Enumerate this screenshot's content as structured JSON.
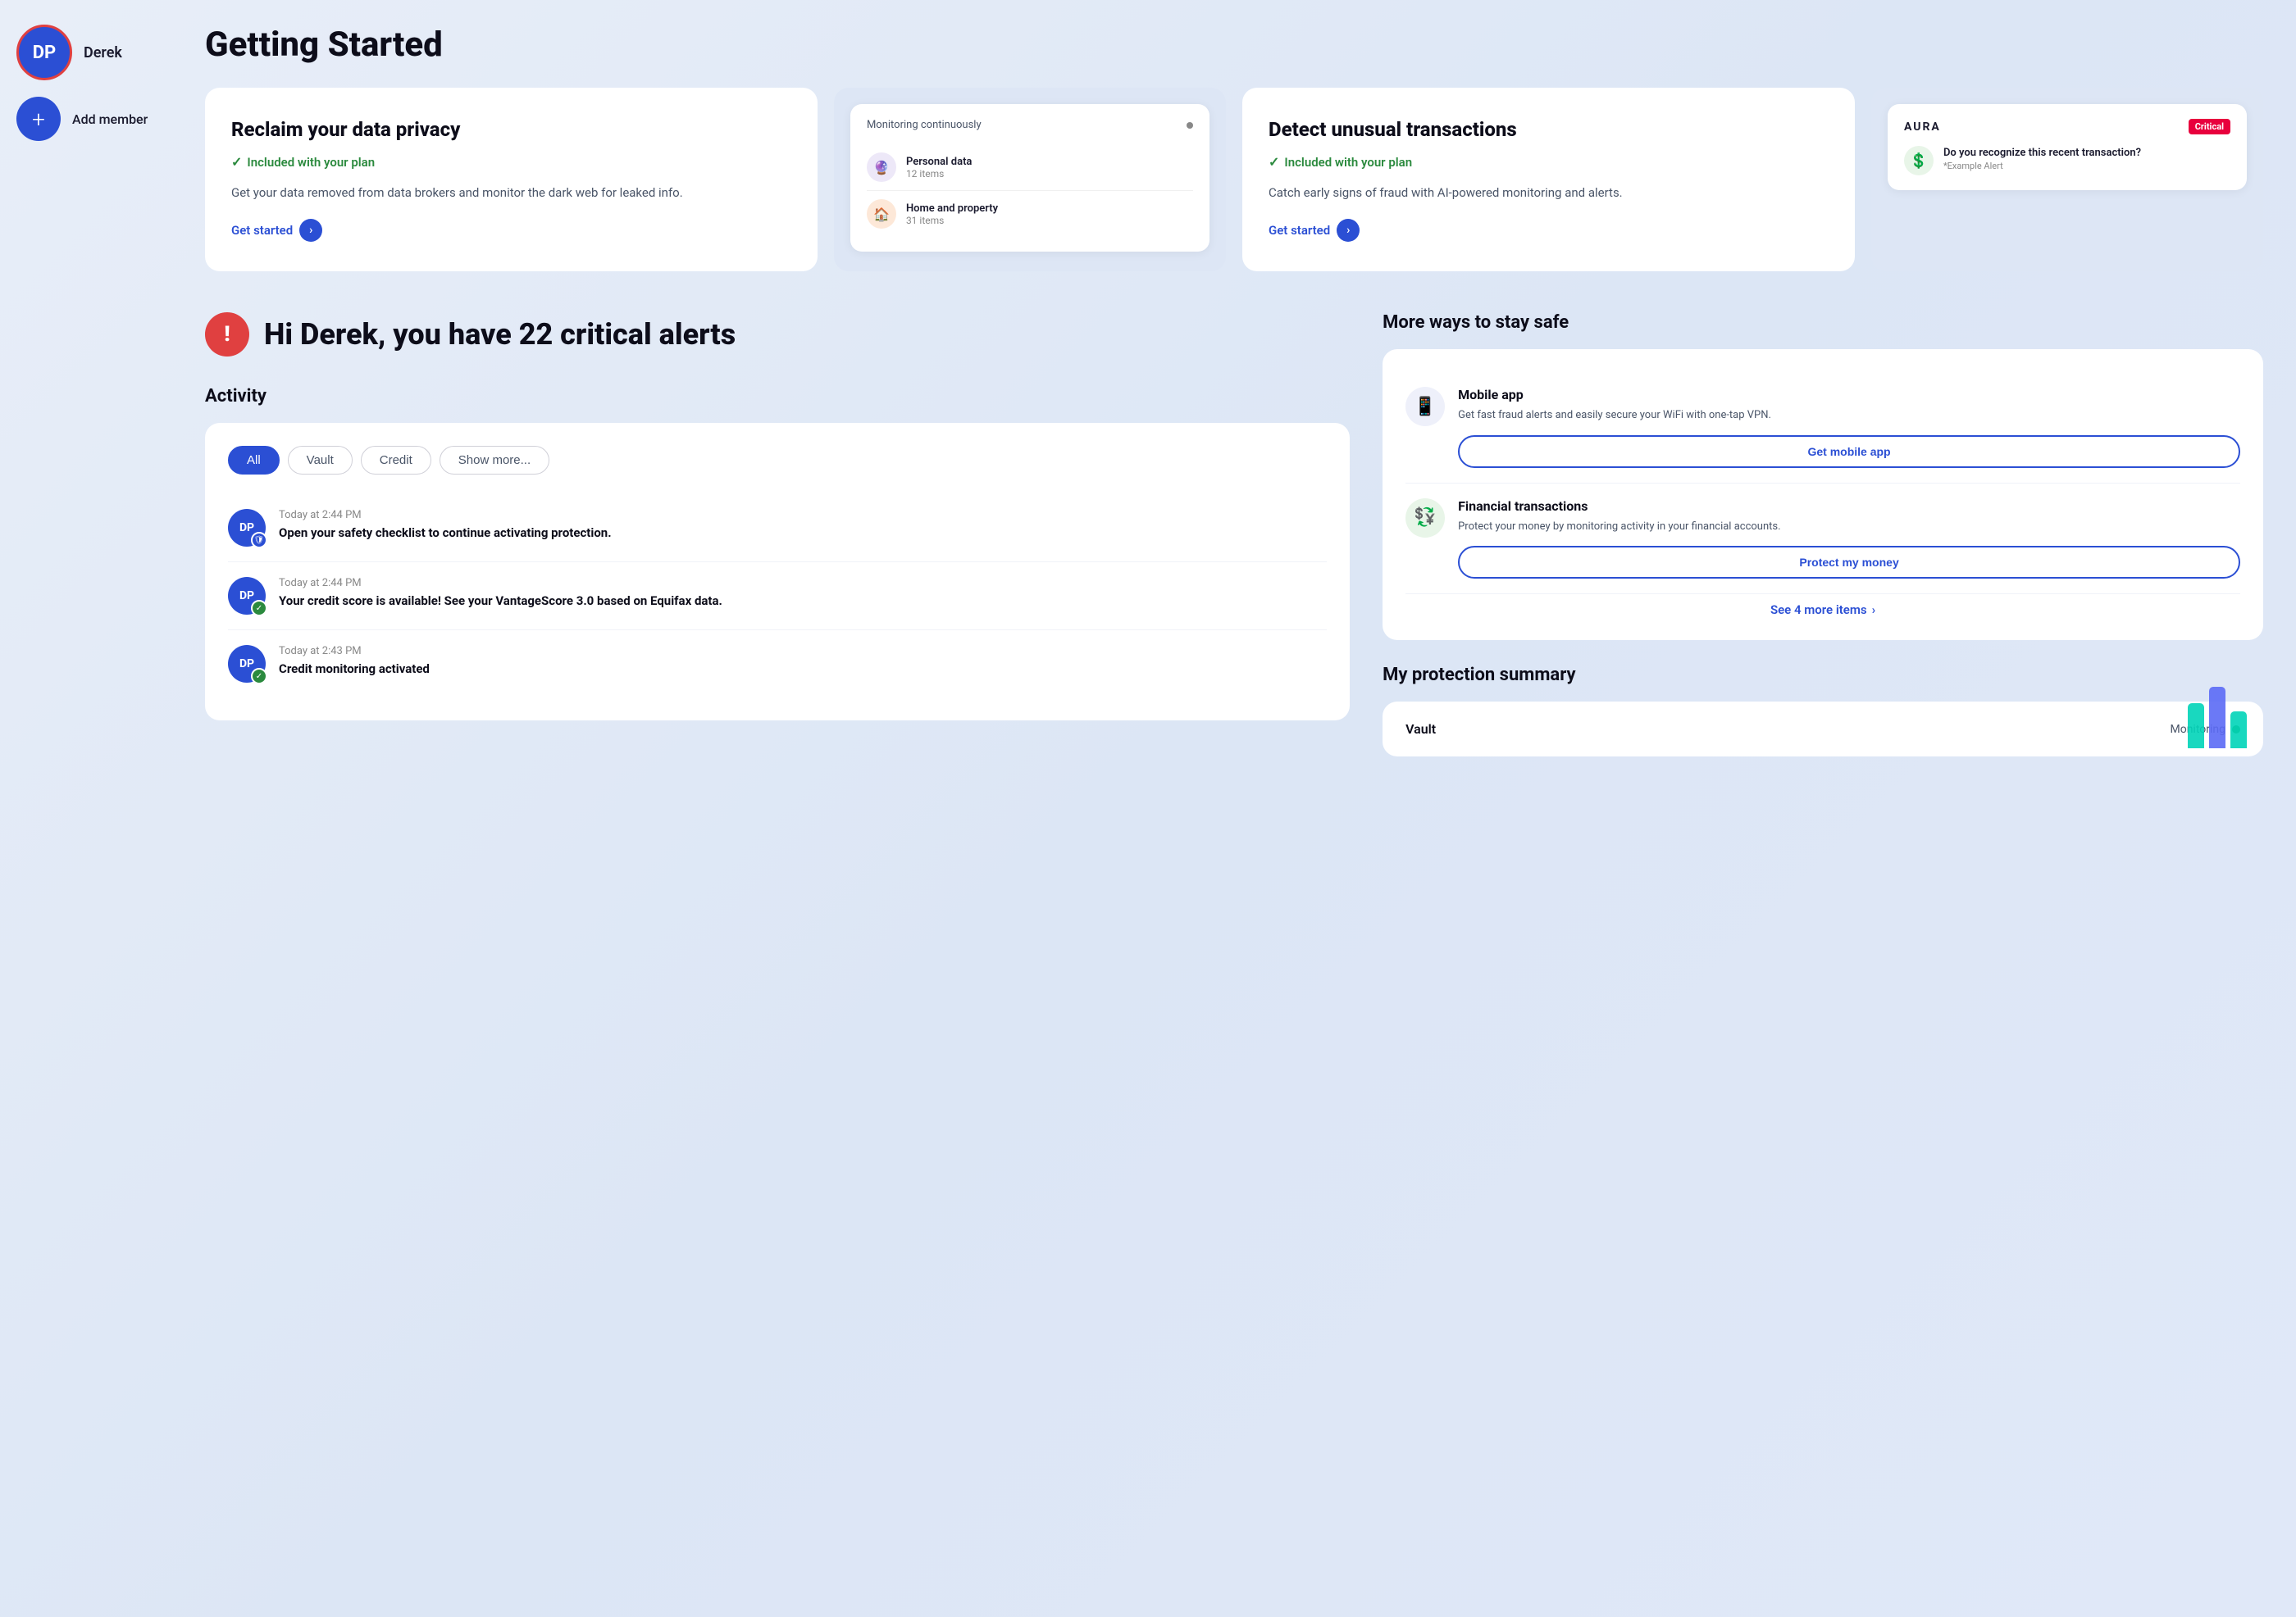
{
  "sidebar": {
    "user_initials": "DP",
    "user_name": "Derek",
    "add_member_label": "Add member",
    "add_icon": "+"
  },
  "header": {
    "title": "Getting Started"
  },
  "cards": [
    {
      "id": "data-privacy",
      "title": "Reclaim your data privacy",
      "badge": "Included with your plan",
      "description": "Get your data removed from data brokers and monitor the dark web for leaked info.",
      "link_label": "Get started"
    },
    {
      "id": "monitoring",
      "header_label": "Monitoring continuously",
      "items": [
        {
          "icon": "🔮",
          "title": "Personal data",
          "count": "12 items"
        },
        {
          "icon": "🏠",
          "title": "Home and property",
          "count": "31 items"
        }
      ]
    },
    {
      "id": "unusual-transactions",
      "title": "Detect unusual transactions",
      "badge": "Included with your plan",
      "description": "Catch early signs of fraud with AI-powered monitoring and alerts.",
      "link_label": "Get started"
    },
    {
      "id": "aura-alert",
      "logo": "AURA",
      "badge": "Critical",
      "alert_text": "Do you recognize this recent transaction?",
      "alert_sub": "*Example Alert"
    }
  ],
  "alert": {
    "user_name": "Derek",
    "count": "22",
    "title": "Hi Derek, you have 22 critical alerts"
  },
  "activity": {
    "section_title": "Activity",
    "filters": [
      {
        "label": "All",
        "active": true
      },
      {
        "label": "Vault",
        "active": false
      },
      {
        "label": "Credit",
        "active": false
      },
      {
        "label": "Show more...",
        "active": false
      }
    ],
    "items": [
      {
        "initials": "DP",
        "time": "Today at 2:44 PM",
        "text": "Open your safety checklist to continue activating protection.",
        "badge_type": "shield"
      },
      {
        "initials": "DP",
        "time": "Today at 2:44 PM",
        "text": "Your credit score is available! See your VantageScore 3.0 based on Equifax data.",
        "badge_type": "check-green"
      },
      {
        "initials": "DP",
        "time": "Today at 2:43 PM",
        "text": "Credit monitoring activated",
        "badge_type": "check-green"
      }
    ]
  },
  "stay_safe": {
    "title": "More ways to stay safe",
    "items": [
      {
        "icon": "📱",
        "icon_bg": "light-blue",
        "title": "Mobile app",
        "description": "Get fast fraud alerts and easily secure your WiFi with one-tap VPN.",
        "btn_label": "Get mobile app"
      },
      {
        "icon": "💱",
        "icon_bg": "green",
        "title": "Financial transactions",
        "description": "Protect your money by monitoring activity in your financial accounts.",
        "btn_label": "Protect my money"
      }
    ],
    "see_more_label": "See 4 more items",
    "see_more_count": "4"
  },
  "protection": {
    "title": "My protection summary",
    "vault_label": "Vault",
    "status_label": "Monitoring",
    "chart_bars": [
      {
        "height": 60,
        "color": "#00d4b8"
      },
      {
        "height": 80,
        "color": "#5b6af5"
      },
      {
        "height": 50,
        "color": "#00d4b8"
      }
    ]
  }
}
